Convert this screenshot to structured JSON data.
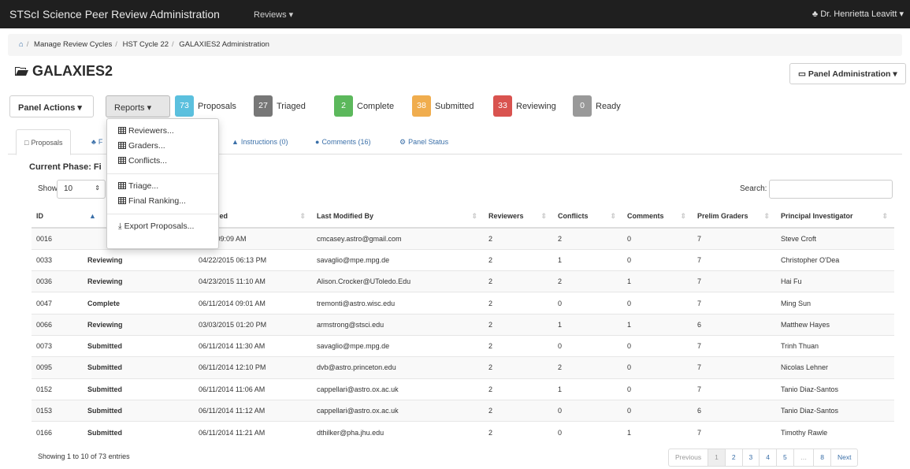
{
  "navbar": {
    "brand": "STScI Science Peer Review Administration",
    "reviews_menu": "Reviews ▾",
    "user": "♣ Dr. Henrietta Leavitt ▾"
  },
  "breadcrumb": {
    "home_icon": "⌂",
    "items": [
      "Manage Review Cycles",
      "HST Cycle 22",
      "GALAXIES2 Administration"
    ]
  },
  "page": {
    "title": "GALAXIES2",
    "title_icon": "folder-open-icon"
  },
  "buttons": {
    "panel_admin": "▭ Panel Administration ▾",
    "panel_actions": "Panel Actions ▾",
    "reports": "Reports ▾"
  },
  "stats": [
    {
      "count": "73",
      "label": "Proposals",
      "color": "#5bc0de"
    },
    {
      "count": "27",
      "label": "Triaged",
      "color": "#777777"
    },
    {
      "count": "2",
      "label": "Complete",
      "color": "#5cb85c"
    },
    {
      "count": "38",
      "label": "Submitted",
      "color": "#f0ad4e"
    },
    {
      "count": "33",
      "label": "Reviewing",
      "color": "#d9534f"
    },
    {
      "count": "0",
      "label": "Ready",
      "color": "#999999"
    }
  ],
  "tabs": [
    {
      "icon": "□",
      "label": "Proposals"
    },
    {
      "icon": "♣",
      "label": "F"
    },
    {
      "icon": "▲",
      "label": "Instructions (0)"
    },
    {
      "icon": "●",
      "label": "Comments (16)"
    },
    {
      "icon": "⚙",
      "label": "Panel Status"
    }
  ],
  "phase": {
    "text": "Current Phase: Fi"
  },
  "table_controls": {
    "show_label": "Show",
    "show_value": "10",
    "search_label": "Search:"
  },
  "table": {
    "headers": [
      "ID",
      "",
      "Modified",
      "Last Modified By",
      "Reviewers",
      "Conflicts",
      "Comments",
      "Prelim Graders",
      "Principal Investigator"
    ],
    "rows": [
      [
        "0016",
        "",
        "2014 09:09 AM",
        "cmcasey.astro@gmail.com",
        "2",
        "2",
        "0",
        "7",
        "Steve Croft"
      ],
      [
        "0033",
        "Reviewing",
        "04/22/2015 06:13 PM",
        "savaglio@mpe.mpg.de",
        "2",
        "1",
        "0",
        "7",
        "Christopher O'Dea"
      ],
      [
        "0036",
        "Reviewing",
        "04/23/2015 11:10 AM",
        "Alison.Crocker@UToledo.Edu",
        "2",
        "2",
        "1",
        "7",
        "Hai Fu"
      ],
      [
        "0047",
        "Complete",
        "06/11/2014 09:01 AM",
        "tremonti@astro.wisc.edu",
        "2",
        "0",
        "0",
        "7",
        "Ming Sun"
      ],
      [
        "0066",
        "Reviewing",
        "03/03/2015 01:20 PM",
        "armstrong@stsci.edu",
        "2",
        "1",
        "1",
        "6",
        "Matthew Hayes"
      ],
      [
        "0073",
        "Submitted",
        "06/11/2014 11:30 AM",
        "savaglio@mpe.mpg.de",
        "2",
        "0",
        "0",
        "7",
        "Trinh Thuan"
      ],
      [
        "0095",
        "Submitted",
        "06/11/2014 12:10 PM",
        "dvb@astro.princeton.edu",
        "2",
        "2",
        "0",
        "7",
        "Nicolas Lehner"
      ],
      [
        "0152",
        "Submitted",
        "06/11/2014 11:06 AM",
        "cappellari@astro.ox.ac.uk",
        "2",
        "1",
        "0",
        "7",
        "Tanio Diaz-Santos"
      ],
      [
        "0153",
        "Submitted",
        "06/11/2014 11:12 AM",
        "cappellari@astro.ox.ac.uk",
        "2",
        "0",
        "0",
        "6",
        "Tanio Diaz-Santos"
      ],
      [
        "0166",
        "Submitted",
        "06/11/2014 11:21 AM",
        "dthilker@pha.jhu.edu",
        "2",
        "0",
        "1",
        "7",
        "Timothy Rawle"
      ]
    ]
  },
  "footer": {
    "showing": "Showing 1 to 10 of 73 entries"
  },
  "pagination": [
    "Previous",
    "1",
    "2",
    "3",
    "4",
    "5",
    "…",
    "8",
    "Next"
  ],
  "reports_menu": {
    "group1": [
      "Reviewers...",
      "Graders...",
      "Conflicts..."
    ],
    "group2": [
      "Triage...",
      "Final Ranking..."
    ],
    "export": "Export Proposals...",
    "export_icon": "⤓"
  }
}
